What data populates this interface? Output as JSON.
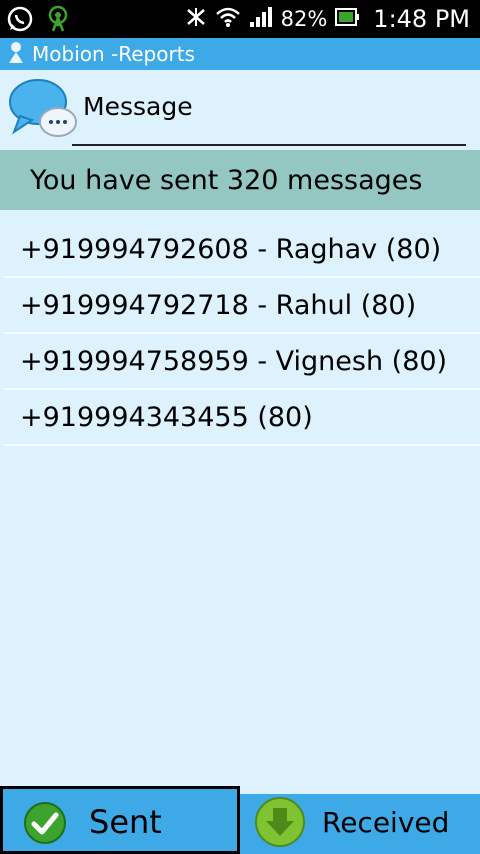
{
  "status_bar": {
    "battery": "82%",
    "time": "1:48 PM",
    "icons": [
      "whatsapp-icon",
      "signal-tower-icon",
      "bluetooth-off-icon",
      "wifi-icon",
      "cell-signal-icon",
      "battery-icon"
    ]
  },
  "app": {
    "title": "Mobion -Reports"
  },
  "header": {
    "label": "Message"
  },
  "summary": {
    "text": "You have sent 320 messages"
  },
  "contacts": [
    "+919994792608 - Raghav (80)",
    "+919994792718 - Rahul (80)",
    "+919994758959 - Vignesh (80)",
    "+919994343455 (80)"
  ],
  "tabs": {
    "sent_label": "Sent",
    "received_label": "Received",
    "selected": "Sent"
  },
  "colors": {
    "status_bar": "#000000",
    "title_bar": "#3ea9e7",
    "background": "#ddf2fd",
    "summary_bar": "#94c7c1",
    "check_green": "#3da32f"
  }
}
